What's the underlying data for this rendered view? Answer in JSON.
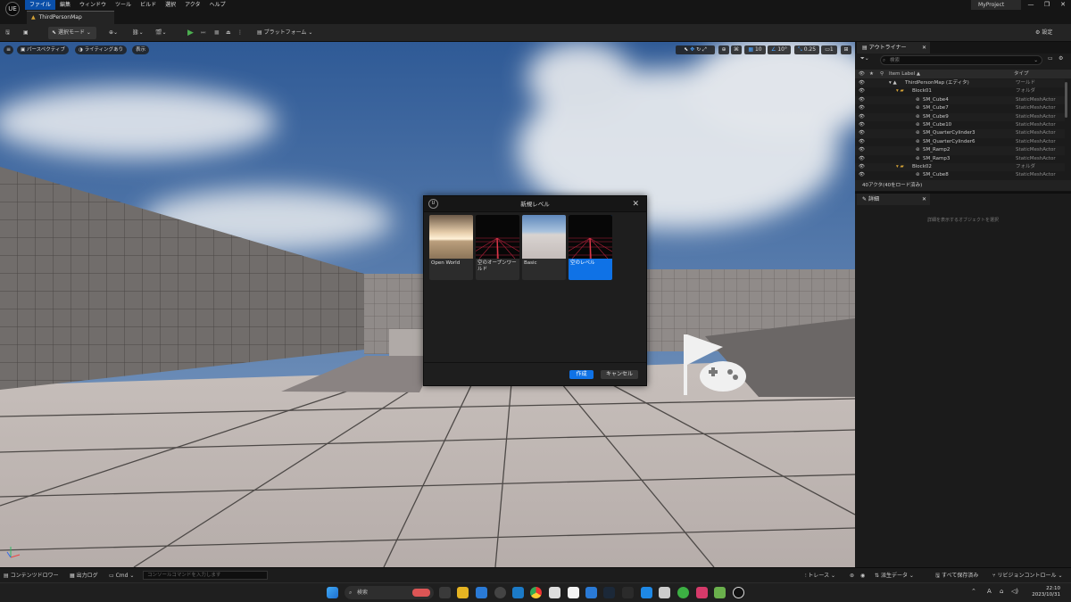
{
  "menubar": {
    "logo": "UE",
    "menus": [
      "ファイル",
      "編集",
      "ウィンドウ",
      "ツール",
      "ビルド",
      "選択",
      "アクタ",
      "ヘルプ"
    ],
    "project": "MyProject",
    "window_controls": [
      "—",
      "❐",
      "✕"
    ]
  },
  "tab": {
    "map_name": "ThirdPersonMap"
  },
  "toolbar": {
    "select_mode": "選択モード",
    "platform": "プラットフォーム",
    "settings": "設定"
  },
  "viewport": {
    "perspective": "パースペクティブ",
    "lighting": "ライティングあり",
    "show": "表示",
    "grid_snap": "10",
    "rot_snap": "10°",
    "scale_snap": "0.25",
    "camera_speed": "1"
  },
  "dialog": {
    "title": "新規レベル",
    "templates": [
      {
        "label": "Open World",
        "selected": false
      },
      {
        "label": "空のオープンワールド",
        "selected": false
      },
      {
        "label": "Basic",
        "selected": false
      },
      {
        "label": "空のレベル",
        "selected": true
      }
    ],
    "create": "作成",
    "cancel": "キャンセル"
  },
  "outliner": {
    "tab": "アウトライナー",
    "search_placeholder": "検索",
    "col_label": "Item Label ▲",
    "col_type": "タイプ",
    "rows": [
      {
        "label": "ThirdPersonMap (エディタ)",
        "type": "ワールド",
        "indent": 0,
        "kind": "world"
      },
      {
        "label": "Block01",
        "type": "フォルダ",
        "indent": 1,
        "kind": "folder"
      },
      {
        "label": "SM_Cube4",
        "type": "StaticMeshActor",
        "indent": 2,
        "kind": "actor"
      },
      {
        "label": "SM_Cube7",
        "type": "StaticMeshActor",
        "indent": 2,
        "kind": "actor"
      },
      {
        "label": "SM_Cube9",
        "type": "StaticMeshActor",
        "indent": 2,
        "kind": "actor"
      },
      {
        "label": "SM_Cube10",
        "type": "StaticMeshActor",
        "indent": 2,
        "kind": "actor"
      },
      {
        "label": "SM_QuarterCylinder3",
        "type": "StaticMeshActor",
        "indent": 2,
        "kind": "actor"
      },
      {
        "label": "SM_QuarterCylinder6",
        "type": "StaticMeshActor",
        "indent": 2,
        "kind": "actor"
      },
      {
        "label": "SM_Ramp2",
        "type": "StaticMeshActor",
        "indent": 2,
        "kind": "actor"
      },
      {
        "label": "SM_Ramp3",
        "type": "StaticMeshActor",
        "indent": 2,
        "kind": "actor"
      },
      {
        "label": "Block02",
        "type": "フォルダ",
        "indent": 1,
        "kind": "folder"
      },
      {
        "label": "SM_Cube8",
        "type": "StaticMeshActor",
        "indent": 2,
        "kind": "actor"
      }
    ],
    "count": "40アクタ(40をロード済み)"
  },
  "details": {
    "tab": "詳細",
    "hint": "詳細を表示するオブジェクトを選択"
  },
  "bottombar": {
    "content_drawer": "コンテンツドロワー",
    "output_log": "出力ログ",
    "cmd": "Cmd",
    "console_placeholder": "コンソールコマンドを入力します",
    "trace": "トレース",
    "derived_data": "派生データ",
    "save_all": "すべて保存済み",
    "revision_control": "リビジョンコントロール"
  },
  "taskbar": {
    "search": "検索",
    "time": "22:10",
    "date": "2023/10/31"
  }
}
